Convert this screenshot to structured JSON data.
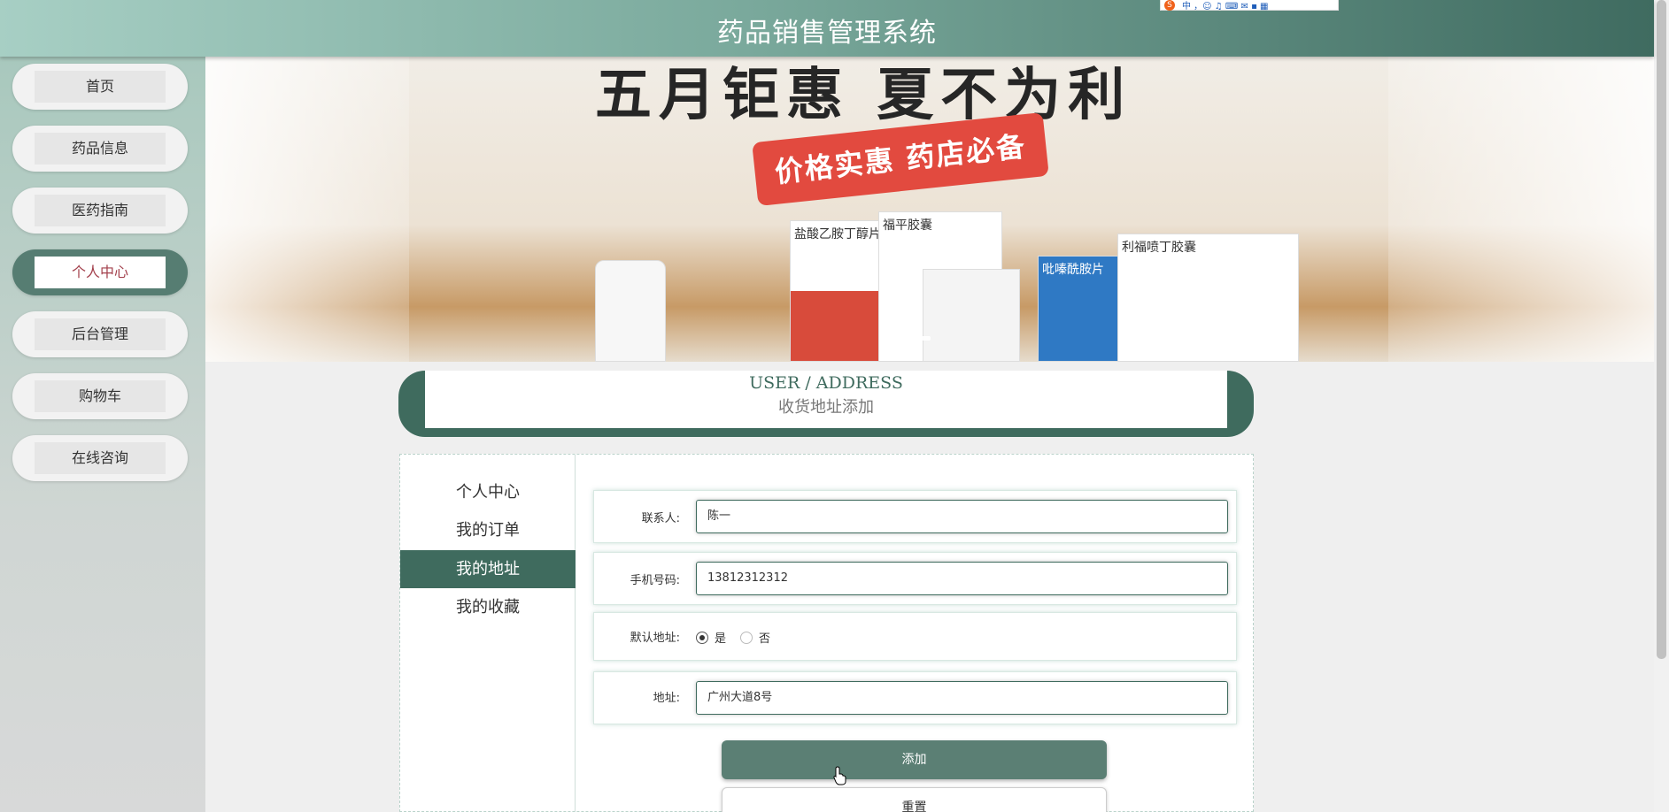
{
  "header": {
    "title": "药品销售管理系统"
  },
  "ime": {
    "logo": "S",
    "text": "中 ，☺ ♫ ⌨ ✉ ▪ ▦"
  },
  "sidebar": {
    "items": [
      {
        "label": "首页",
        "active": false
      },
      {
        "label": "药品信息",
        "active": false
      },
      {
        "label": "医药指南",
        "active": false
      },
      {
        "label": "个人中心",
        "active": true
      },
      {
        "label": "后台管理",
        "active": false
      },
      {
        "label": "购物车",
        "active": false
      },
      {
        "label": "在线咨询",
        "active": false
      }
    ]
  },
  "banner": {
    "headline": "五月钜惠 夏不为利",
    "ribbon": "价格实惠 药店必备",
    "boxes": [
      "盐酸乙胺丁醇片",
      "福平胶囊",
      "吡嗪酰胺片",
      "利福喷丁胶囊"
    ]
  },
  "section": {
    "title_en": "USER / ADDRESS",
    "title_cn": "收货地址添加"
  },
  "user_menu": {
    "items": [
      {
        "label": "个人中心",
        "active": false
      },
      {
        "label": "我的订单",
        "active": false
      },
      {
        "label": "我的地址",
        "active": true
      },
      {
        "label": "我的收藏",
        "active": false
      }
    ]
  },
  "form": {
    "contact": {
      "label": "联系人:",
      "value": "陈一"
    },
    "phone": {
      "label": "手机号码:",
      "value": "13812312312"
    },
    "default": {
      "label": "默认地址:",
      "options": [
        "是",
        "否"
      ],
      "selected": "是"
    },
    "address": {
      "label": "地址:",
      "value": "广州大道8号"
    },
    "submit_label": "添加",
    "reset_label": "重置"
  },
  "colors": {
    "accent": "#3f6b5e",
    "header_start": "#a7cfc4",
    "header_end": "#3f6b60",
    "active_text": "#a3404c"
  }
}
